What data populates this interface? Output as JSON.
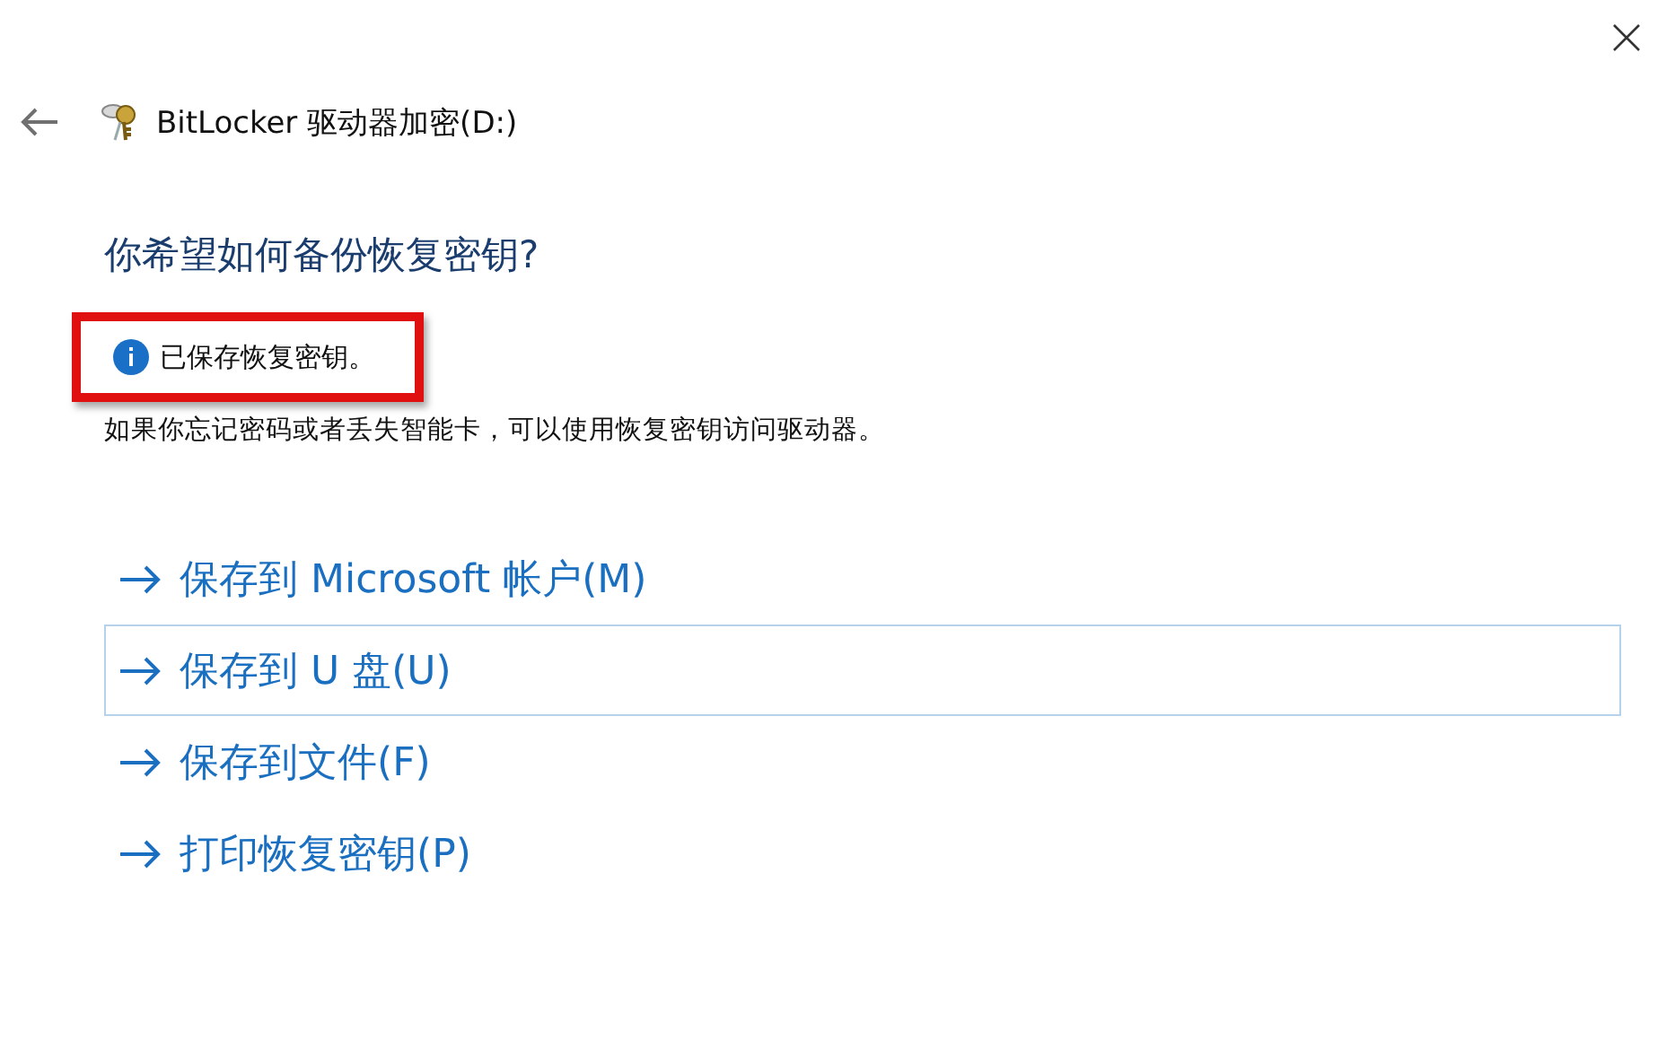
{
  "window": {
    "title": "BitLocker 驱动器加密(D:)"
  },
  "heading": "你希望如何备份恢复密钥?",
  "notice": {
    "text": "已保存恢复密钥。",
    "highlighted": true
  },
  "description": "如果你忘记密码或者丢失智能卡，可以使用恢复密钥访问驱动器。",
  "options": [
    {
      "label": "保存到 Microsoft 帐户(M)",
      "focused": false
    },
    {
      "label": "保存到 U 盘(U)",
      "focused": true
    },
    {
      "label": "保存到文件(F)",
      "focused": false
    },
    {
      "label": "打印恢复密钥(P)",
      "focused": false
    }
  ]
}
